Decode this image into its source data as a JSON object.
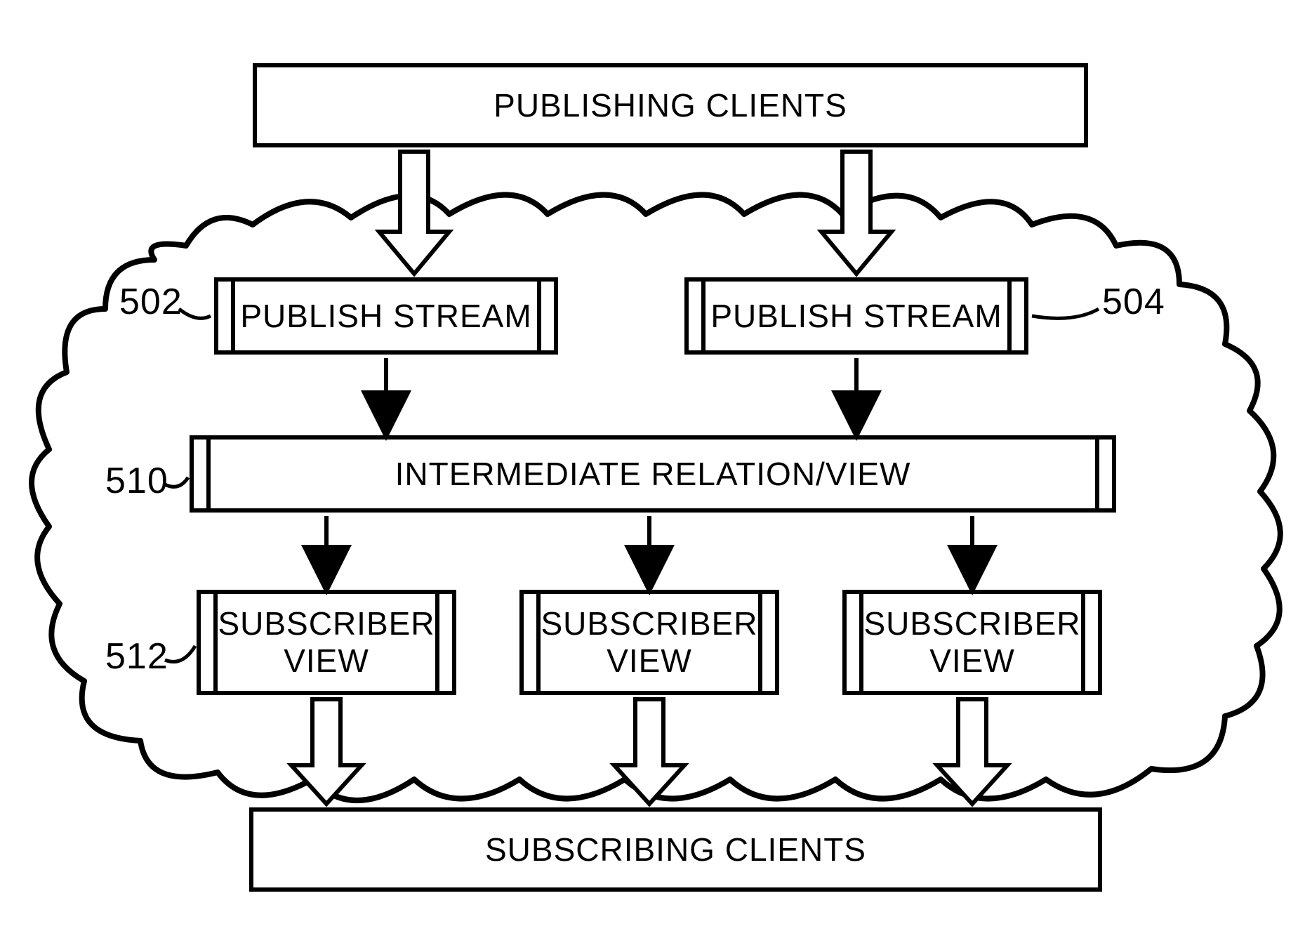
{
  "diagram": {
    "type": "patent-flow-diagram",
    "top_box": "PUBLISHING CLIENTS",
    "publish_stream_left": {
      "label": "PUBLISH STREAM",
      "ref": "502"
    },
    "publish_stream_right": {
      "label": "PUBLISH STREAM",
      "ref": "504"
    },
    "intermediate": {
      "label": "INTERMEDIATE RELATION/VIEW",
      "ref": "510"
    },
    "subscriber_view": {
      "label": "SUBSCRIBER\nVIEW",
      "ref": "512"
    },
    "bottom_box": "SUBSCRIBING CLIENTS"
  }
}
